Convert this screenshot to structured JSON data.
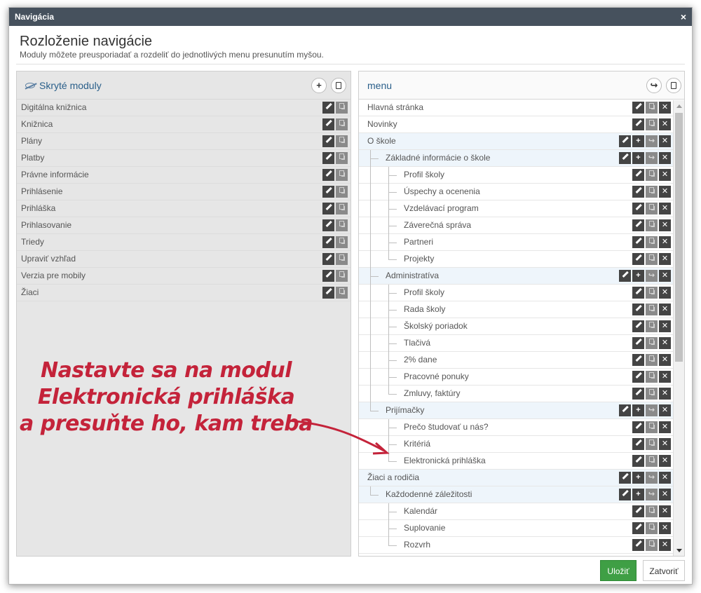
{
  "window": {
    "title": "Navigácia",
    "close": "×"
  },
  "heading": {
    "title": "Rozloženie navigácie",
    "subtitle": "Moduly môžete preusporiadať a rozdeliť do jednotlivých menu presunutím myšou."
  },
  "left_panel": {
    "title": "Skryté moduly",
    "items": [
      "Digitálna knižnica",
      "Knižnica",
      "Plány",
      "Platby",
      "Právne informácie",
      "Prihlásenie",
      "Prihláška",
      "Prihlasovanie",
      "Triedy",
      "Upraviť vzhľad",
      "Verzia pre mobily",
      "Žiaci"
    ]
  },
  "right_panel": {
    "title": "menu",
    "items": [
      {
        "label": "Hlavná stránka",
        "level": 0,
        "group": false
      },
      {
        "label": "Novinky",
        "level": 0,
        "group": false
      },
      {
        "label": "O škole",
        "level": 0,
        "group": true
      },
      {
        "label": "Základné informácie o škole",
        "level": 1,
        "group": true
      },
      {
        "label": "Profil školy",
        "level": 2,
        "group": false
      },
      {
        "label": "Úspechy a ocenenia",
        "level": 2,
        "group": false
      },
      {
        "label": "Vzdelávací program",
        "level": 2,
        "group": false
      },
      {
        "label": "Záverečná správa",
        "level": 2,
        "group": false
      },
      {
        "label": "Partneri",
        "level": 2,
        "group": false
      },
      {
        "label": "Projekty",
        "level": 2,
        "group": false
      },
      {
        "label": "Administratíva",
        "level": 1,
        "group": true
      },
      {
        "label": "Profil školy",
        "level": 2,
        "group": false
      },
      {
        "label": "Rada školy",
        "level": 2,
        "group": false
      },
      {
        "label": "Školský poriadok",
        "level": 2,
        "group": false
      },
      {
        "label": "Tlačivá",
        "level": 2,
        "group": false
      },
      {
        "label": "2% dane",
        "level": 2,
        "group": false
      },
      {
        "label": "Pracovné ponuky",
        "level": 2,
        "group": false
      },
      {
        "label": "Zmluvy, faktúry",
        "level": 2,
        "group": false
      },
      {
        "label": "Prijímačky",
        "level": 1,
        "group": true
      },
      {
        "label": "Prečo študovať u nás?",
        "level": 2,
        "group": false
      },
      {
        "label": "Kritériá",
        "level": 2,
        "group": false
      },
      {
        "label": "Elektronická prihláška",
        "level": 2,
        "group": false
      },
      {
        "label": "Žiaci a rodičia",
        "level": 0,
        "group": true
      },
      {
        "label": "Každodenné záležitosti",
        "level": 1,
        "group": true
      },
      {
        "label": "Kalendár",
        "level": 2,
        "group": false
      },
      {
        "label": "Suplovanie",
        "level": 2,
        "group": false
      },
      {
        "label": "Rozvrh",
        "level": 2,
        "group": false
      }
    ]
  },
  "footer": {
    "save": "Uložiť",
    "close": "Zatvoriť"
  },
  "annotation": [
    "Nastavte sa na modul",
    "Elektronická prihláška",
    "a presuňte ho, kam treba"
  ],
  "colors": {
    "titlebar": "#46515d",
    "save": "#3f9f45",
    "annotation": "#c4233a"
  }
}
